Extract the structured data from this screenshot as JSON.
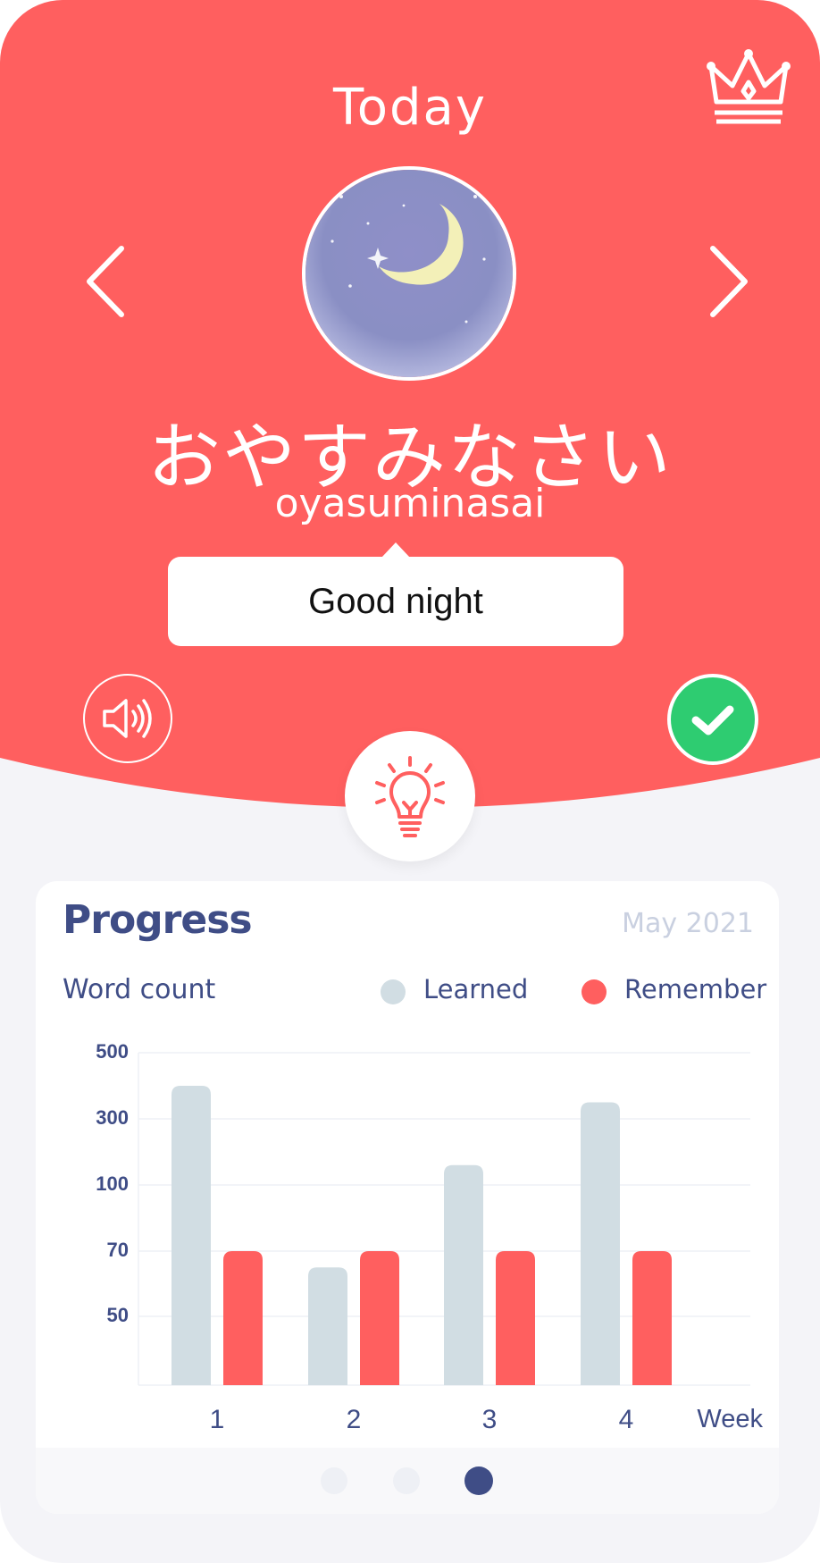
{
  "header": {
    "title": "Today",
    "premium_icon": "crown-icon"
  },
  "colors": {
    "primary": "#ff5f5f",
    "accent_green": "#2ecc71",
    "navy": "#3f4d86",
    "learned": "#d1dde3",
    "remember": "#ff5f5f",
    "background": "#f4f4f8"
  },
  "word": {
    "japanese": "おやすみなさい",
    "romaji": "oyasuminasai",
    "translation": "Good night",
    "image": "moon-night-sky-illustration"
  },
  "controls": {
    "prev_icon": "chevron-left-icon",
    "next_icon": "chevron-right-icon",
    "sound_icon": "speaker-icon",
    "check_icon": "check-icon",
    "hint_icon": "lightbulb-icon"
  },
  "progress": {
    "title": "Progress",
    "date": "May 2021",
    "subtitle": "Word count",
    "legend": {
      "learned": "Learned",
      "remember": "Remember"
    }
  },
  "chart_data": {
    "type": "bar",
    "ylabel": "Word count",
    "xlabel": "Week",
    "y_ticks": [
      "500",
      "300",
      "100",
      "70",
      "50"
    ],
    "categories": [
      "1",
      "2",
      "3",
      "4"
    ],
    "series": [
      {
        "name": "Learned",
        "values": [
          400,
          65,
          160,
          350
        ]
      },
      {
        "name": "Remember",
        "values": [
          70,
          70,
          70,
          70
        ]
      }
    ],
    "grid": true,
    "legend": "top-right"
  },
  "pagination": {
    "count": 3,
    "active_index": 2
  }
}
